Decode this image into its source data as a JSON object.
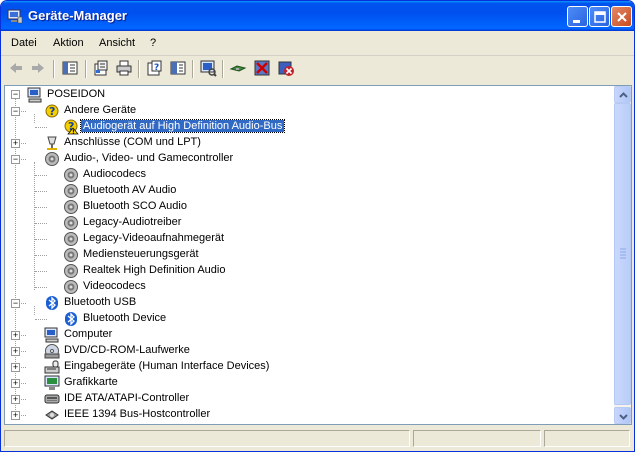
{
  "window": {
    "title": "Geräte-Manager"
  },
  "menu": [
    "Datei",
    "Aktion",
    "Ansicht",
    "?"
  ],
  "toolbar": {
    "buttons": [
      "back-icon",
      "forward-icon",
      "show-hide-console-tree-icon",
      "properties-icon",
      "print-icon",
      "help-icon",
      "export-list-icon",
      "scan-hardware-icon",
      "update-driver-icon",
      "disable-device-icon",
      "uninstall-device-icon"
    ]
  },
  "tree": {
    "root": "POSEIDON",
    "nodes": [
      {
        "label": "Andere Geräte",
        "level": 1,
        "expanded": true,
        "icon": "unknown-device-icon"
      },
      {
        "label": "Audiogerät auf High Definition Audio-Bus",
        "level": 2,
        "selected": true,
        "icon": "unknown-device-warning-icon"
      },
      {
        "label": "Anschlüsse (COM und LPT)",
        "level": 1,
        "expanded": false,
        "icon": "port-icon"
      },
      {
        "label": "Audio-, Video- und Gamecontroller",
        "level": 1,
        "expanded": true,
        "icon": "sound-icon"
      },
      {
        "label": "Audiocodecs",
        "level": 2,
        "icon": "sound-icon"
      },
      {
        "label": "Bluetooth AV Audio",
        "level": 2,
        "icon": "sound-icon"
      },
      {
        "label": "Bluetooth SCO Audio",
        "level": 2,
        "icon": "sound-icon"
      },
      {
        "label": "Legacy-Audiotreiber",
        "level": 2,
        "icon": "sound-icon"
      },
      {
        "label": "Legacy-Videoaufnahmegerät",
        "level": 2,
        "icon": "sound-icon"
      },
      {
        "label": "Mediensteuerungsgerät",
        "level": 2,
        "icon": "sound-icon"
      },
      {
        "label": "Realtek High Definition Audio",
        "level": 2,
        "icon": "sound-icon"
      },
      {
        "label": "Videocodecs",
        "level": 2,
        "icon": "sound-icon"
      },
      {
        "label": "Bluetooth USB",
        "level": 1,
        "expanded": true,
        "icon": "bluetooth-icon"
      },
      {
        "label": "Bluetooth Device",
        "level": 2,
        "icon": "bluetooth-icon"
      },
      {
        "label": "Computer",
        "level": 1,
        "expanded": false,
        "icon": "computer-icon"
      },
      {
        "label": "DVD/CD-ROM-Laufwerke",
        "level": 1,
        "expanded": false,
        "icon": "cdrom-icon"
      },
      {
        "label": "Eingabegeräte (Human Interface Devices)",
        "level": 1,
        "expanded": false,
        "icon": "hid-icon"
      },
      {
        "label": "Grafikkarte",
        "level": 1,
        "expanded": false,
        "icon": "display-adapter-icon"
      },
      {
        "label": "IDE ATA/ATAPI-Controller",
        "level": 1,
        "expanded": false,
        "icon": "ide-controller-icon"
      },
      {
        "label": "IEEE 1394 Bus-Hostcontroller",
        "level": 1,
        "expanded": false,
        "icon": "ieee1394-icon"
      }
    ]
  },
  "colors": {
    "titlebar": "#0053ee",
    "selection": "#316ac5"
  }
}
